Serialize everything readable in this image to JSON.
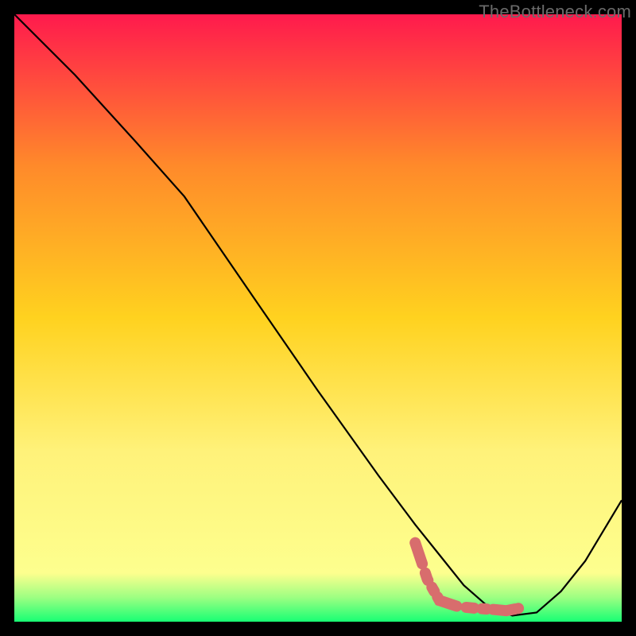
{
  "watermark": "TheBottleneck.com",
  "chart_data": {
    "type": "line",
    "title": "",
    "xlabel": "",
    "ylabel": "",
    "xlim": [
      0,
      100
    ],
    "ylim": [
      0,
      100
    ],
    "grid": false,
    "legend": false,
    "background_gradient": {
      "top": "#ff1a4d",
      "upper_mid": "#ff8a2a",
      "mid": "#ffd21f",
      "lower_mid": "#fff27a",
      "bottom_yellow": "#fdff8e",
      "bottom_green": "#18ff74"
    },
    "series": [
      {
        "name": "bottleneck-curve",
        "color": "#000000",
        "x": [
          0,
          10,
          20,
          28,
          40,
          50,
          60,
          66,
          70,
          74,
          78,
          82,
          86,
          90,
          94,
          100
        ],
        "y": [
          100,
          90,
          79,
          70,
          52.5,
          38,
          24,
          16,
          11,
          6,
          2.5,
          1,
          1.5,
          5,
          10,
          20
        ]
      }
    ],
    "highlight": {
      "name": "optimal-range",
      "color": "#d86d6d",
      "x": [
        66,
        67,
        68,
        70,
        73,
        76,
        79,
        81,
        83
      ],
      "y": [
        13,
        10,
        7,
        3.5,
        2.5,
        2.2,
        2,
        1.8,
        2.2
      ]
    }
  }
}
